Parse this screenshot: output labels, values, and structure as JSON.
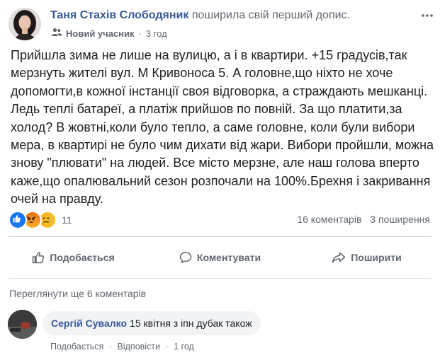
{
  "post": {
    "author_name": "Таня Стахів Слободяник",
    "action_text": "поширила свій перший допис.",
    "badge": "Новий учасник",
    "time_separator": "·",
    "time": "3 год",
    "text": "Прийшла зима не лише на вулицю, а і в квартири. +15 градусів,так мерзнуть жителі вул. М Кривоноса 5. А головне,що ніхто не хоче допомогти,в кожної інстанції своя відговорка, а страждають мешканці. Ледь теплі батареї, а платіж прийшов по повній. За що платити,за холод? В жовтні,коли було тепло, а саме головне, коли були вибори мера, в квартирі не було чим дихати від жари. Вибори пройшли, можна знову \"плювати\" на людей. Все місто мерзне, але наш голова вперто каже,що опалювальний сезон розпочали на 100%.Брехня і закривання очей на правду."
  },
  "reactions": {
    "types": [
      "like",
      "angry",
      "sad"
    ],
    "count": "11"
  },
  "stats": {
    "comments": "16 коментарів",
    "shares": "3 поширення"
  },
  "actions": {
    "like": "Подобається",
    "comment": "Коментувати",
    "share": "Поширити"
  },
  "comments": {
    "view_more": "Переглянути ще 6 коментарів",
    "items": [
      {
        "author": "Сергій Сувалко",
        "text": "15 квітня з іпн дубак також",
        "like": "Подобається",
        "reply": "Відповісти",
        "separator": "·",
        "time": "1 год"
      }
    ]
  },
  "colors": {
    "link": "#385898",
    "secondary": "#616770",
    "like_blue": "#1877f2",
    "divider": "#dadde1",
    "bubble": "#f2f3f5"
  },
  "icons": [
    "more-icon",
    "friends-icon",
    "like-icon",
    "angry-icon",
    "sad-icon",
    "thumb-icon",
    "comment-icon",
    "share-icon"
  ]
}
